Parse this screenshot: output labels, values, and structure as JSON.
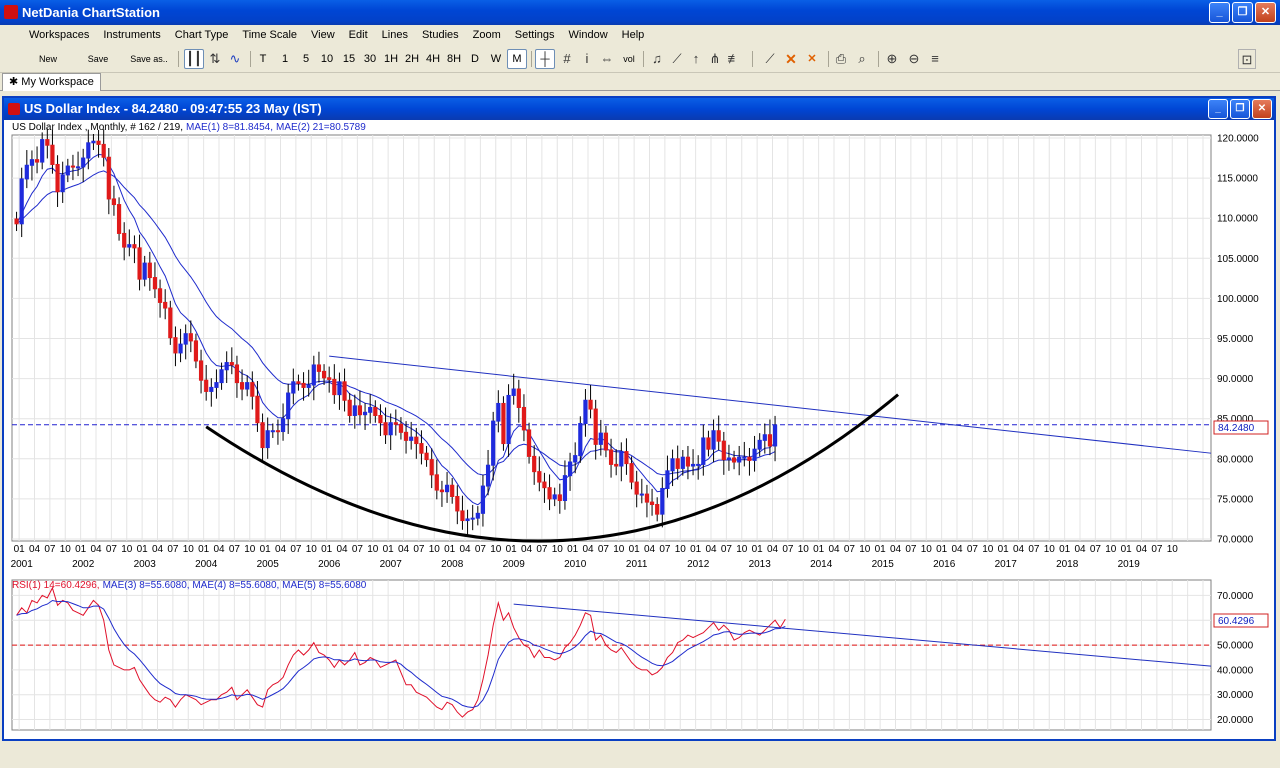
{
  "app": {
    "title": "NetDania ChartStation"
  },
  "menu": [
    "Workspaces",
    "Instruments",
    "Chart Type",
    "Time Scale",
    "View",
    "Edit",
    "Lines",
    "Studies",
    "Zoom",
    "Settings",
    "Window",
    "Help"
  ],
  "toolbar": {
    "new_label": "New",
    "save_label": "Save",
    "save_as_label": "Save as..",
    "intervals": [
      "T",
      "1",
      "5",
      "10",
      "15",
      "30",
      "1H",
      "2H",
      "4H",
      "8H",
      "D",
      "W",
      "M"
    ],
    "active_interval": "M",
    "vol_label": "vol"
  },
  "workspace_tab": {
    "label": "My Workspace"
  },
  "chart_window": {
    "title": "US Dollar Index - 84.2480 - 09:47:55  23 May (IST)",
    "price_legend": "US Dollar Index , Monthly, # 162 / 219,",
    "mae1": "MAE(1) 8=81.8454,",
    "mae2": "MAE(2) 21=80.5789",
    "rsi_legend": "RSI(1) 14=60.4296,",
    "rsi_mae_legend": "MAE(3) 8=55.6080, MAE(4) 8=55.6080, MAE(5) 8=55.6080",
    "current_price_label": "84.2480",
    "current_rsi_label": "60.4296"
  },
  "colors": {
    "up_candle": "#1f2bdc",
    "down_candle": "#e01a1a",
    "ma_line": "#1f2bcc",
    "trend_line": "#2030c0",
    "cup_curve": "#000000",
    "rsi_line": "#e0102a",
    "rsi_mid": "#e01010",
    "price_dash": "#2020d0"
  },
  "chart_data": [
    {
      "type": "candlestick",
      "title": "US Dollar Index , Monthly",
      "ylim": [
        70,
        120
      ],
      "y_ticks": [
        "120.0000",
        "115.0000",
        "110.0000",
        "105.0000",
        "100.0000",
        "95.0000",
        "90.0000",
        "85.0000",
        "80.0000",
        "75.0000",
        "70.0000"
      ],
      "month_ticks": [
        "01",
        "04",
        "07",
        "10"
      ],
      "years": [
        "2001",
        "2002",
        "2003",
        "2004",
        "2005",
        "2006",
        "2007",
        "2008",
        "2009",
        "2010",
        "2011",
        "2012",
        "2013",
        "2014",
        "2015",
        "2016",
        "2017",
        "2018",
        "2019"
      ],
      "last_tick_label": "01 04",
      "last_price": 84.248,
      "series": [
        {
          "name": "US Dollar Index",
          "start": "2000-12",
          "close": [
            109.3,
            114.9,
            116.6,
            117.3,
            117.0,
            119.8,
            119.1,
            116.7,
            113.3,
            115.4,
            116.5,
            116.4,
            116.4,
            117.5,
            119.4,
            119.6,
            119.2,
            117.6,
            112.4,
            111.7,
            108.1,
            106.4,
            106.7,
            106.3,
            102.4,
            104.4,
            102.6,
            101.2,
            99.5,
            98.8,
            95.1,
            93.2,
            94.3,
            95.6,
            94.7,
            92.2,
            89.8,
            88.4,
            88.9,
            89.5,
            91.1,
            92.0,
            91.7,
            89.5,
            88.7,
            89.5,
            87.8,
            84.5,
            81.4,
            83.5,
            83.5,
            83.4,
            85.0,
            88.2,
            89.6,
            89.4,
            88.9,
            89.2,
            91.7,
            90.9,
            90.1,
            89.9,
            88.0,
            89.6,
            87.3,
            85.4,
            86.6,
            85.5,
            85.8,
            86.4,
            85.4,
            84.5,
            83.0,
            84.5,
            84.3,
            83.3,
            82.3,
            82.7,
            81.9,
            80.7,
            79.9,
            78.0,
            76.1,
            75.9,
            76.7,
            75.3,
            73.5,
            72.3,
            72.5,
            72.6,
            73.2,
            76.6,
            79.2,
            84.7,
            86.9,
            81.9,
            87.9,
            88.7,
            86.4,
            83.6,
            80.3,
            78.4,
            77.1,
            76.4,
            75.0,
            75.5,
            74.8,
            77.9,
            79.6,
            80.4,
            84.4,
            87.3,
            86.2,
            81.8,
            83.2,
            81.1,
            79.3,
            79.1,
            80.9,
            79.4,
            77.1,
            75.6,
            75.6,
            74.6,
            74.3,
            73.1,
            76.3,
            78.5,
            80.0,
            78.8,
            80.2,
            79.1,
            79.3,
            79.3,
            82.6,
            81.2,
            83.5,
            82.2,
            79.9,
            80.1,
            79.6,
            80.2,
            80.2,
            79.8,
            81.2,
            82.3,
            83.0,
            81.6,
            84.2
          ]
        },
        {
          "name": "MAE(1) 8",
          "last": 81.8454
        },
        {
          "name": "MAE(2) 21",
          "last": 80.5789
        }
      ],
      "annotations": {
        "resistance_line": [
          {
            "date": "2006-01",
            "value": 92.8
          },
          {
            "date": "2019-06",
            "value": 80.7
          }
        ],
        "cup_curve": [
          {
            "date": "2004-01",
            "value": 84
          },
          {
            "date": "2009-10",
            "value": 69.8
          },
          {
            "date": "2015-04",
            "value": 88
          }
        ],
        "price_line": 84.248
      }
    },
    {
      "type": "line",
      "title": "RSI(1) 14",
      "ylim": [
        17,
        75
      ],
      "y_ticks": [
        "70.0000",
        "60.0000",
        "50.0000",
        "40.0000",
        "30.0000",
        "20.0000"
      ],
      "mid_line": 50,
      "last_value": 60.4296,
      "series": [
        {
          "name": "RSI(1) 14",
          "start": "2000-12",
          "values": [
            62,
            65,
            63,
            68,
            67,
            70,
            69,
            73,
            66,
            68,
            67,
            64,
            63,
            62,
            65,
            68,
            66,
            60,
            48,
            42,
            41,
            40,
            40,
            41,
            36,
            33,
            30,
            28,
            27,
            29,
            28,
            25,
            28,
            30,
            29,
            28,
            26,
            27,
            28,
            28,
            30,
            31,
            33,
            28,
            30,
            32,
            29,
            26,
            25,
            32,
            34,
            35,
            37,
            42,
            46,
            48,
            46,
            48,
            51,
            47,
            46,
            44,
            41,
            44,
            42,
            44,
            47,
            42,
            43,
            45,
            44,
            41,
            42,
            43,
            44,
            39,
            34,
            34,
            31,
            30,
            29,
            27,
            25,
            24,
            27,
            26,
            23,
            21,
            23,
            24,
            28,
            36,
            46,
            58,
            67,
            60,
            63,
            57,
            53,
            50,
            49,
            45,
            48,
            45,
            45,
            44,
            45,
            49,
            51,
            54,
            58,
            63,
            62,
            52,
            54,
            50,
            48,
            47,
            49,
            46,
            43,
            41,
            40,
            40,
            38,
            39,
            41,
            45,
            47,
            51,
            52,
            54,
            53,
            54,
            55,
            57,
            59,
            56,
            58,
            56,
            52,
            53,
            55,
            56,
            55,
            54,
            56,
            58,
            60,
            57,
            60.4
          ]
        },
        {
          "name": "MAE(3) 8",
          "last": 55.608
        },
        {
          "name": "MAE(4) 8",
          "last": 55.608
        },
        {
          "name": "MAE(5) 8",
          "last": 55.608
        }
      ],
      "annotations": {
        "trend_line": [
          {
            "date": "2009-01",
            "value": 66.5
          },
          {
            "date": "2019-06",
            "value": 41.5
          }
        ]
      }
    }
  ]
}
